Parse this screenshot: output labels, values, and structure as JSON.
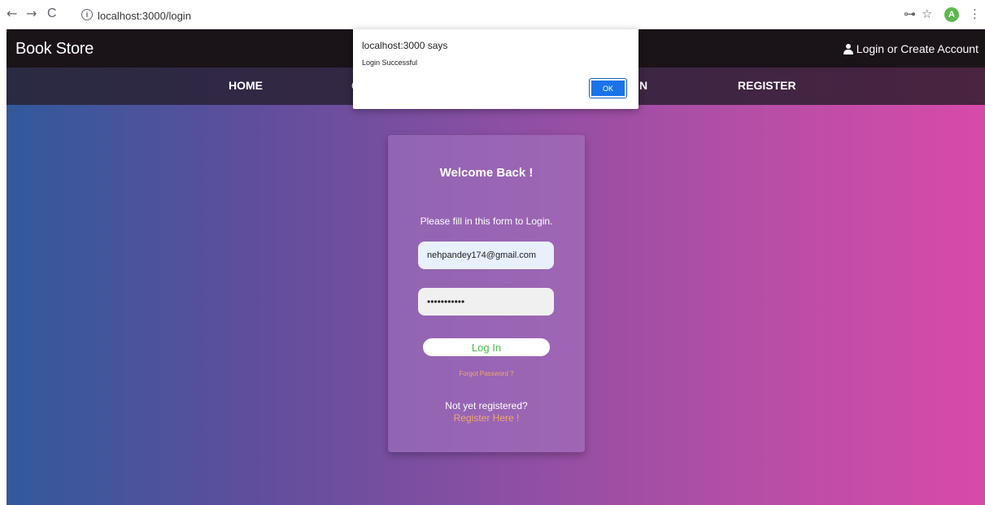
{
  "browser": {
    "back_icon": "←",
    "forward_icon": "→",
    "reload_icon": "C",
    "url": "localhost:3000/login",
    "key_icon": "⊶",
    "star_icon": "☆",
    "avatar_letter": "A",
    "menu_icon": "⋮"
  },
  "header": {
    "brand": "Book Store",
    "account_link": "Login or Create Account"
  },
  "nav": {
    "home": "HOME",
    "register": "REGISTER"
  },
  "login": {
    "title": "Welcome Back !",
    "subtitle": "Please fill in this form to Login.",
    "email_value": "nehpandey174@gmail.com",
    "password_value": "•••••••••••",
    "login_button": "Log In",
    "forgot": "Forgot Password ?",
    "not_registered": "Not yet registered?",
    "register_link": "Register Here !"
  },
  "dialog": {
    "title": "localhost:3000 says",
    "message": "Login Successful",
    "ok_label": "OK"
  },
  "colors": {
    "accent_green": "#4cb84c",
    "link_orange": "#f0a86a",
    "dialog_button": "#1a73e8"
  }
}
